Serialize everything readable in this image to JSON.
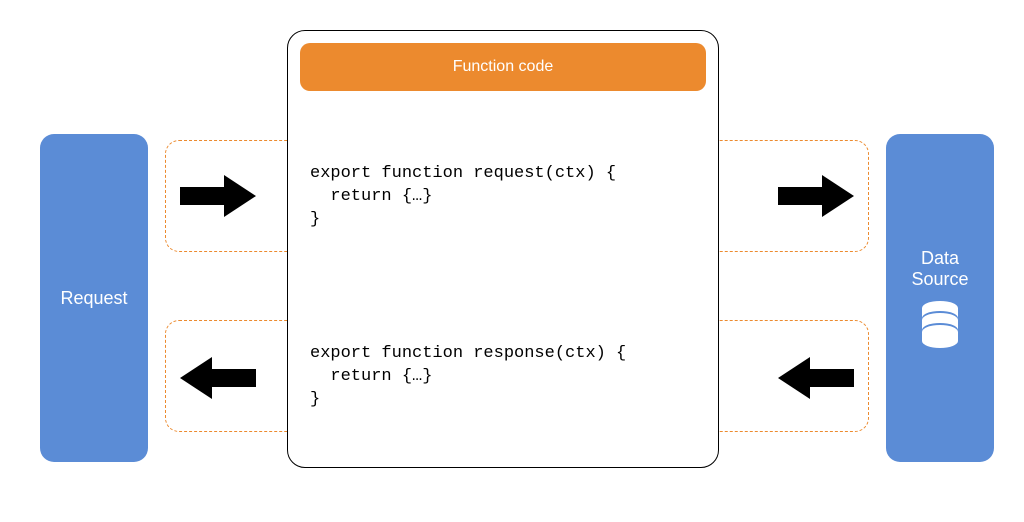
{
  "request": {
    "label": "Request"
  },
  "datasource": {
    "line1": "Data",
    "line2": "Source"
  },
  "function": {
    "header": "Function code"
  },
  "code": {
    "request": "export function request(ctx) {\n  return {…}\n}",
    "response": "export function response(ctx) {\n  return {…}\n}"
  }
}
